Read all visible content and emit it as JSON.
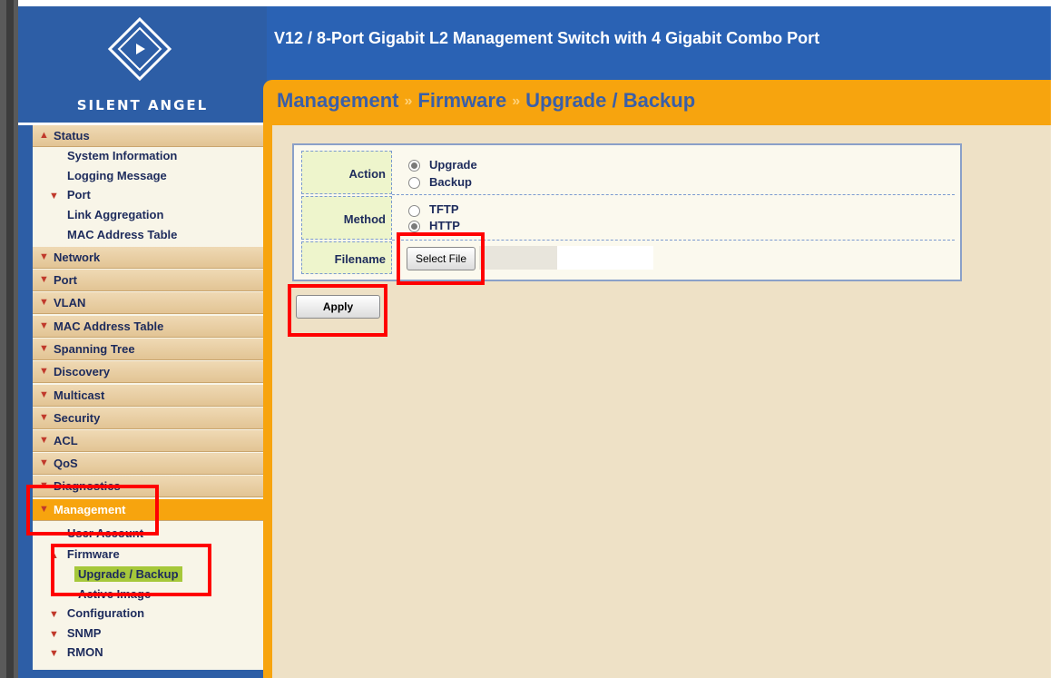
{
  "header": {
    "title": "V12 / 8-Port Gigabit L2 Management Switch with 4 Gigabit Combo Port",
    "brand": "SILENT ANGEL",
    "logo_icon": "play-diamond-icon"
  },
  "breadcrumb": {
    "items": [
      "Management",
      "Firmware",
      "Upgrade / Backup"
    ],
    "separator": "»"
  },
  "sidebar": {
    "status": {
      "label": "Status",
      "children": [
        "System Information",
        "Logging Message",
        "Port",
        "Link Aggregation",
        "MAC Address Table"
      ]
    },
    "menu": [
      "Network",
      "Port",
      "VLAN",
      "MAC Address Table",
      "Spanning Tree",
      "Discovery",
      "Multicast",
      "Security",
      "ACL",
      "QoS",
      "Diagnostics",
      "Management"
    ],
    "management_children": {
      "user_account": "User Account",
      "firmware": "Firmware",
      "upgrade_backup": "Upgrade / Backup",
      "active_image": "Active Image",
      "configuration": "Configuration",
      "snmp": "SNMP",
      "rmon": "RMON"
    }
  },
  "form": {
    "action": {
      "label": "Action",
      "options": [
        "Upgrade",
        "Backup"
      ],
      "selected": "Upgrade"
    },
    "method": {
      "label": "Method",
      "options": [
        "TFTP",
        "HTTP"
      ],
      "selected": "HTTP"
    },
    "filename": {
      "label": "Filename",
      "button": "Select File"
    },
    "apply_button": "Apply"
  },
  "colors": {
    "header_blue": "#2a62b4",
    "accent_orange": "#f7a40e",
    "content_bg": "#eee1c6",
    "highlight_green": "#a6c83a",
    "annotation_red": "#ff0000"
  }
}
